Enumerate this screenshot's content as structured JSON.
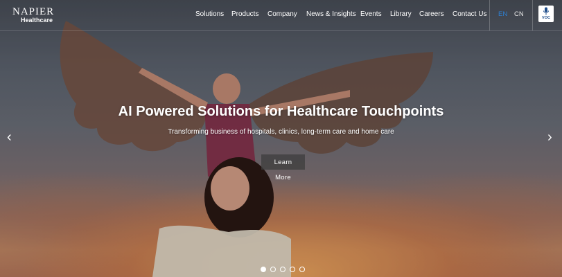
{
  "header": {
    "logo": {
      "name": "NAPIER",
      "subtitle": "Healthcare"
    },
    "nav": [
      {
        "label": "Solutions"
      },
      {
        "label": "Products"
      },
      {
        "label": "Company"
      },
      {
        "label": "News & Insights"
      },
      {
        "label": "Events"
      },
      {
        "label": "Library"
      },
      {
        "label": "Careers"
      },
      {
        "label": "Contact Us"
      }
    ],
    "languages": [
      {
        "label": "EN",
        "active": true
      },
      {
        "label": "CN",
        "active": false
      }
    ],
    "voc_label": "VOC"
  },
  "hero": {
    "headline": "AI Powered Solutions for Healthcare Touchpoints",
    "subheadline": "Transforming business of hospitals, clinics, long-term care and home care",
    "cta_label": "Learn More",
    "prev_arrow": "‹",
    "next_arrow": "›",
    "slides_total": 5,
    "slide_active": 1
  },
  "icons": {
    "voc": "microphone-icon",
    "prev": "chevron-left-icon",
    "next": "chevron-right-icon"
  },
  "colors": {
    "lang_active": "#2e7fd0",
    "voc_text": "#1f4e8c",
    "sunset": "#f3aa5f"
  }
}
